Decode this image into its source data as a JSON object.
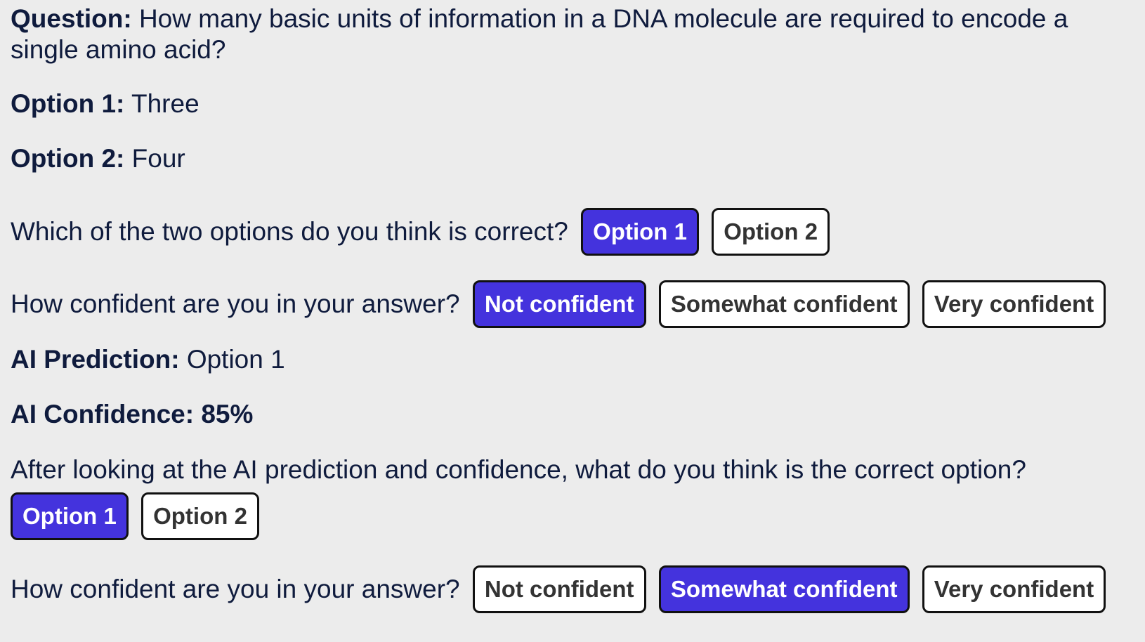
{
  "question": {
    "label": "Question:",
    "text": "How many basic units of information in a DNA molecule are required to encode a single amino acid?"
  },
  "option1": {
    "label": "Option 1:",
    "text": "Three"
  },
  "option2": {
    "label": "Option 2:",
    "text": "Four"
  },
  "initial_choice": {
    "prompt": "Which of the two options do you think is correct?",
    "buttons": [
      "Option 1",
      "Option 2"
    ],
    "selected": "Option 1"
  },
  "initial_confidence": {
    "prompt": "How confident are you in your answer?",
    "buttons": [
      "Not confident",
      "Somewhat confident",
      "Very confident"
    ],
    "selected": "Not confident"
  },
  "ai_prediction": {
    "label": "AI Prediction:",
    "value": "Option 1"
  },
  "ai_confidence": {
    "label": "AI Confidence:",
    "value": "85%"
  },
  "final_choice": {
    "prompt": "After looking at the AI prediction and confidence, what do you think is the correct option?",
    "buttons": [
      "Option 1",
      "Option 2"
    ],
    "selected": "Option 1"
  },
  "final_confidence": {
    "prompt": "How confident are you in your answer?",
    "buttons": [
      "Not confident",
      "Somewhat confident",
      "Very confident"
    ],
    "selected": "Somewhat confident"
  },
  "colors": {
    "background": "#ececec",
    "text": "#0f1b3d",
    "selected_button": "#4433dd",
    "button_border": "#111111"
  }
}
